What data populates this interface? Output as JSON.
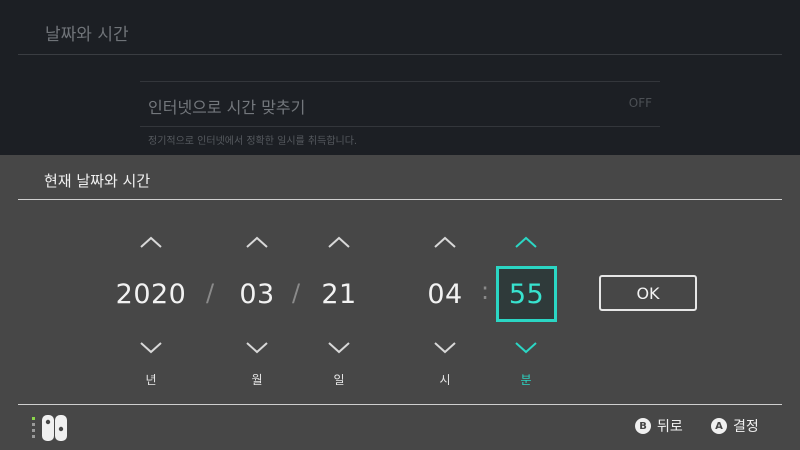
{
  "background": {
    "title": "날짜와 시간",
    "setting_label": "인터넷으로 시간 맞추기",
    "setting_value": "OFF",
    "setting_description": "정기적으로 인터넷에서 정확한 일시를 취득합니다."
  },
  "dialog": {
    "title": "현재 날짜와 시간",
    "year": {
      "value": "2020",
      "unit": "년"
    },
    "month": {
      "value": "03",
      "unit": "월"
    },
    "day": {
      "value": "21",
      "unit": "일"
    },
    "hour": {
      "value": "04",
      "unit": "시"
    },
    "minute": {
      "value": "55",
      "unit": "분"
    },
    "date_separator": "/",
    "time_separator": ":",
    "ok_label": "OK",
    "selected_field": "minute"
  },
  "footer": {
    "back_button_glyph": "B",
    "back_label": "뒤로",
    "confirm_button_glyph": "A",
    "confirm_label": "결정"
  },
  "colors": {
    "accent": "#2bd6c4",
    "panel": "#474747",
    "background": "#1c1f24"
  },
  "icons": [
    "chevron-up-icon",
    "chevron-down-icon",
    "joycon-controller-icon"
  ]
}
